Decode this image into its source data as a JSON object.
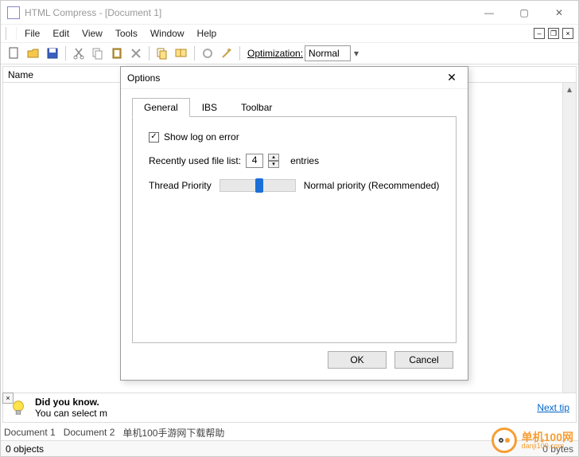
{
  "window": {
    "title": "HTML Compress - [Document 1]"
  },
  "menu": {
    "file": "File",
    "edit": "Edit",
    "view": "View",
    "tools": "Tools",
    "window": "Window",
    "help": "Help"
  },
  "toolbar": {
    "optimization_label": "Optimization:",
    "optimization_value": "Normal"
  },
  "main": {
    "column_name": "Name"
  },
  "tip": {
    "heading": "Did you know.",
    "body": "You can select m",
    "next": "Next tip"
  },
  "doctabs": {
    "d1": "Document 1",
    "d2": "Document 2",
    "d3": "单机100手游网下载帮助"
  },
  "status": {
    "left": "0 objects",
    "right": "0 bytes"
  },
  "watermark": {
    "line1": "单机100网",
    "line2": "danji100.com"
  },
  "dialog": {
    "title": "Options",
    "tabs": {
      "general": "General",
      "ibs": "IBS",
      "toolbar": "Toolbar"
    },
    "show_log_label": "Show log on error",
    "show_log_checked": true,
    "recent_label_pre": "Recently used file list:",
    "recent_value": "4",
    "recent_label_post": "entries",
    "thread_label": "Thread Priority",
    "thread_desc": "Normal priority (Recommended)",
    "ok": "OK",
    "cancel": "Cancel"
  }
}
